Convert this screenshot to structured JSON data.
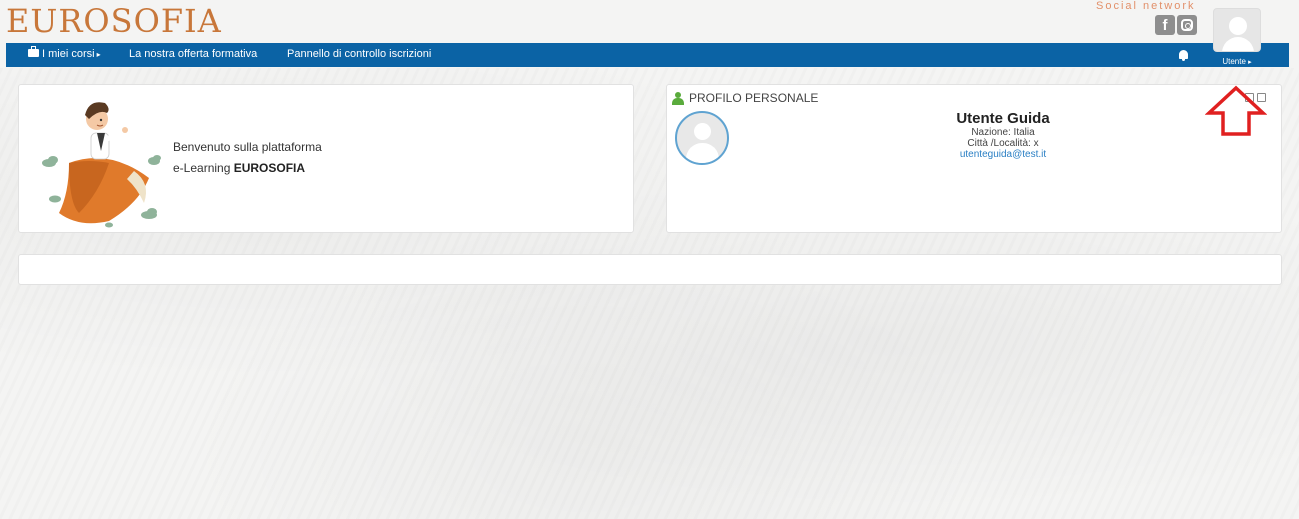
{
  "brand": {
    "logo_text": "EUROSOFIA",
    "accent_color": "#c8773a"
  },
  "social": {
    "label": "Social network",
    "icons": [
      "facebook-icon",
      "instagram-icon"
    ],
    "facebook_glyph": "f"
  },
  "nav": {
    "bg_color": "#0b63a5",
    "items": [
      {
        "label": "I miei corsi",
        "icon": "briefcase-icon",
        "has_caret": true
      },
      {
        "label": "La nostra offerta formativa"
      },
      {
        "label": "Pannello di controllo iscrizioni"
      }
    ],
    "notification_icon": "bell-icon"
  },
  "user_menu": {
    "label": "Utente",
    "avatar_icon": "user-avatar-icon"
  },
  "welcome": {
    "line1": "Benvenuto sulla plattaforma",
    "line2_prefix": "e-Learning ",
    "line2_bold": "EUROSOFIA",
    "illustration": "mascot-illustration"
  },
  "profile": {
    "header": "PROFILO PERSONALE",
    "name": "Utente Guida",
    "nation": "Nazione: Italia",
    "city": "Città /Località: x",
    "email": "utenteguida@test.it",
    "header_icon_color": "#5aab3c",
    "avatar_ring_color": "#5fa3d1",
    "email_color": "#2a7fc4"
  },
  "annotation": {
    "arrow_color": "#e02020",
    "arrow_direction": "up"
  }
}
